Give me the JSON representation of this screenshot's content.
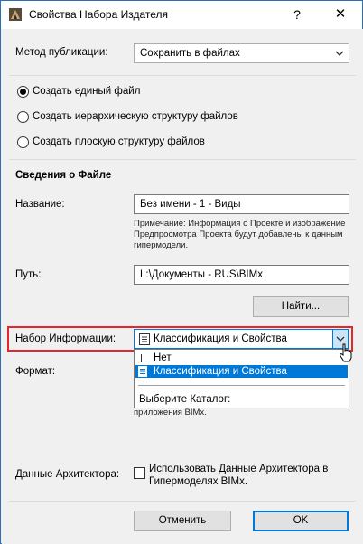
{
  "window": {
    "title": "Свойства Набора Издателя",
    "help_glyph": "?",
    "close_glyph": "✕"
  },
  "publish_method": {
    "label": "Метод публикации:",
    "value": "Сохранить в файлах"
  },
  "structure": {
    "options": [
      {
        "label": "Создать единый файл",
        "checked": true
      },
      {
        "label": "Создать иерархическую структуру файлов",
        "checked": false
      },
      {
        "label": "Создать плоскую структуру файлов",
        "checked": false
      }
    ]
  },
  "file_info": {
    "heading": "Сведения о Файле",
    "name_label": "Название:",
    "name_value": "Без имени - 1 - Виды",
    "note_line1": "Примечание: Информация о Проекте и изображение",
    "note_line2": "Предпросмотра Проекта будут добавлены к данным",
    "note_line3": "гипермодели.",
    "path_label": "Путь:",
    "path_value": "L:\\Документы - RUS\\BIMx",
    "find_button": "Найти..."
  },
  "info_set": {
    "label": "Набор Информации:",
    "value": "Классификация и Свойства",
    "dropdown": {
      "item_none": "Нет",
      "item_selected": "Классификация и Свойства",
      "item_catalog": "Выберите Каталог:"
    }
  },
  "format": {
    "label": "Формат:",
    "note_tail": "приложения BIMx."
  },
  "architect_data": {
    "label": "Данные Архитектора:",
    "checkbox_line1": "Использовать Данные Архитектора в",
    "checkbox_line2": "Гипермоделях BIMx.",
    "checked": false
  },
  "footer": {
    "cancel_button": "Отменить",
    "ok_button": "OK"
  },
  "colors": {
    "accent": "#0078d7",
    "highlight": "#e8242c"
  }
}
